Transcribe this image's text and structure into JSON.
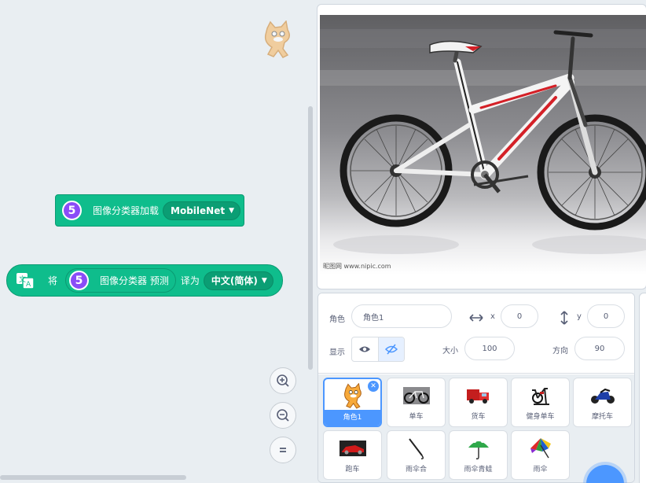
{
  "code_area": {
    "block_load": {
      "icon_text": "5",
      "label": "图像分类器加载",
      "model_value": "MobileNet"
    },
    "block_translate": {
      "prefix": "将",
      "inner_icon_text": "5",
      "inner_label": "图像分类器 预测",
      "middle": "译为",
      "language_value": "中文(简体)"
    }
  },
  "stage": {
    "watermark": "昵图网 www.nipic.com"
  },
  "sprite_info": {
    "sprite_label": "角色",
    "sprite_name": "角色1",
    "x_label": "x",
    "x_value": "0",
    "y_label": "y",
    "y_value": "0",
    "show_label": "显示",
    "size_label": "大小",
    "size_value": "100",
    "direction_label": "方向",
    "direction_value": "90"
  },
  "sprites": [
    {
      "name": "角色1",
      "thumb": "cat"
    },
    {
      "name": "单车",
      "thumb": "bicycle"
    },
    {
      "name": "货车",
      "thumb": "truck"
    },
    {
      "name": "健身单车",
      "thumb": "exercise-bike"
    },
    {
      "name": "摩托车",
      "thumb": "motorcycle"
    },
    {
      "name": "跑车",
      "thumb": "sports-car"
    },
    {
      "name": "雨伞合",
      "thumb": "closed-umbrella"
    },
    {
      "name": "雨伞青蛙",
      "thumb": "frog-umbrella"
    },
    {
      "name": "雨伞",
      "thumb": "umbrella"
    }
  ],
  "colors": {
    "extension_green": "#0fbd8c",
    "extension_icon_purple": "#8a4cf7",
    "selection_blue": "#4c97ff",
    "bike_red": "#d42027"
  }
}
